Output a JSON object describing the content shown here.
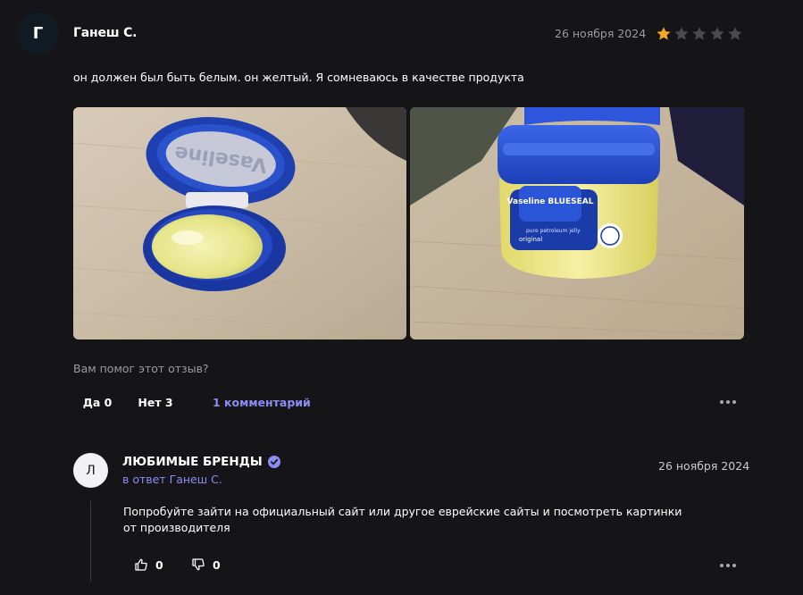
{
  "review": {
    "avatar_letter": "Г",
    "author": "Ганеш С.",
    "date": "26 ноября 2024",
    "rating": 1,
    "rating_max": 5,
    "text": "он должен был быть белым. он желтый. Я сомневаюсь в качестве продукта",
    "photo_label": "Vaseline",
    "photo2_label": "Vaseline BLUESEAL",
    "helpful_question": "Вам помог этот отзыв?",
    "yes_label": "Да 0",
    "no_label": "Нет 3",
    "comments_label": "1 комментарий"
  },
  "reply": {
    "avatar_letter": "Л",
    "author": "ЛЮБИМЫЕ БРЕНДЫ",
    "reply_to": "в ответ Ганеш С.",
    "date": "26 ноября 2024",
    "text": "Попробуйте зайти на официальный сайт или другое еврейские сайты и посмотреть картинки от производителя",
    "likes": "0",
    "dislikes": "0"
  },
  "colors": {
    "background": "#151417",
    "accent_link": "#8c8cf5",
    "star_filled": "#f5a623",
    "star_empty": "#4a4a50",
    "verified": "#8c8cf5"
  },
  "icons": [
    "star-icon",
    "verified-icon",
    "thumbs-up-icon",
    "thumbs-down-icon",
    "more-icon"
  ]
}
